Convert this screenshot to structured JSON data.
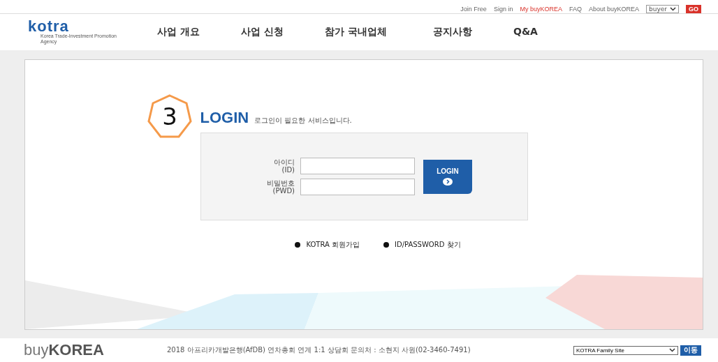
{
  "utility_links": [
    {
      "label": "Join Free",
      "highlight": false
    },
    {
      "label": "Sign in",
      "highlight": false
    },
    {
      "label": "My buyKOREA",
      "highlight": true
    },
    {
      "label": "FAQ",
      "highlight": false
    },
    {
      "label": "About buyKOREA",
      "highlight": false
    }
  ],
  "user_type_select": {
    "value": "buyer"
  },
  "go_button": "GO",
  "logo": {
    "name": "kotra",
    "tagline": "Korea Trade-Investment Promotion Agency"
  },
  "nav": [
    "사업 개요",
    "사업 신청",
    "참가 국내업체",
    "공지사항",
    "Q&A"
  ],
  "step_marker": "3",
  "login": {
    "title": "LOGIN",
    "subtitle": "로그인이 필요한 서비스입니다.",
    "fields": [
      {
        "label": "아이디",
        "sublabel": "(ID)"
      },
      {
        "label": "비밀번호",
        "sublabel": "(PWD)"
      }
    ],
    "button": "LOGIN"
  },
  "links": [
    "KOTRA 회원가입",
    "ID/PASSWORD 찾기"
  ],
  "footer": {
    "brand_light": "buy",
    "brand_bold": "KOREA",
    "notice": "2018 아프리카개발은행(AfDB) 연차총회 연계 1:1 상담회 문의처 : 소현지 사원(02-3460-7491)",
    "family_select": "KOTRA Family Site",
    "move_button": "이동"
  }
}
